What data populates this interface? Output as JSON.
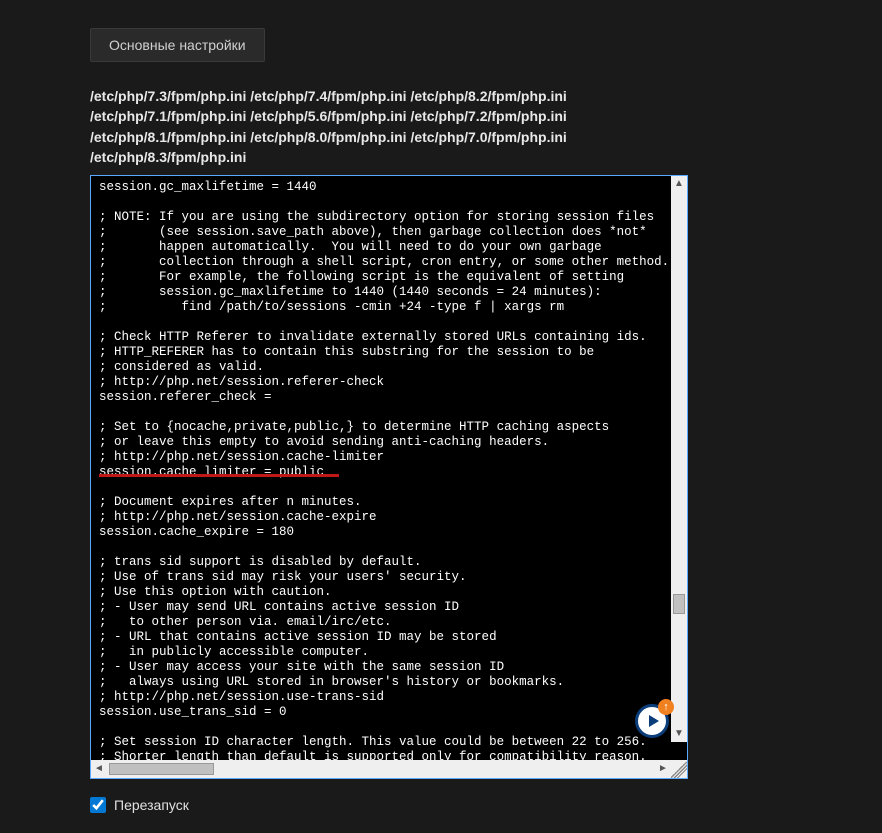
{
  "toolbar": {
    "main_settings_label": "Основные настройки"
  },
  "paths": {
    "line1": "/etc/php/7.3/fpm/php.ini /etc/php/7.4/fpm/php.ini /etc/php/8.2/fpm/php.ini",
    "line2": "/etc/php/7.1/fpm/php.ini /etc/php/5.6/fpm/php.ini /etc/php/7.2/fpm/php.ini",
    "line3": "/etc/php/8.1/fpm/php.ini /etc/php/8.0/fpm/php.ini /etc/php/7.0/fpm/php.ini",
    "line4": "/etc/php/8.3/fpm/php.ini"
  },
  "editor": {
    "content": "session.gc_maxlifetime = 1440\n\n; NOTE: If you are using the subdirectory option for storing session files\n;       (see session.save_path above), then garbage collection does *not*\n;       happen automatically.  You will need to do your own garbage\n;       collection through a shell script, cron entry, or some other method.\n;       For example, the following script is the equivalent of setting\n;       session.gc_maxlifetime to 1440 (1440 seconds = 24 minutes):\n;          find /path/to/sessions -cmin +24 -type f | xargs rm\n\n; Check HTTP Referer to invalidate externally stored URLs containing ids.\n; HTTP_REFERER has to contain this substring for the session to be\n; considered as valid.\n; http://php.net/session.referer-check\nsession.referer_check =\n\n; Set to {nocache,private,public,} to determine HTTP caching aspects\n; or leave this empty to avoid sending anti-caching headers.\n; http://php.net/session.cache-limiter\nsession.cache_limiter = public\n\n; Document expires after n minutes.\n; http://php.net/session.cache-expire\nsession.cache_expire = 180\n\n; trans sid support is disabled by default.\n; Use of trans sid may risk your users' security.\n; Use this option with caution.\n; - User may send URL contains active session ID\n;   to other person via. email/irc/etc.\n; - URL that contains active session ID may be stored\n;   in publicly accessible computer.\n; - User may access your site with the same session ID\n;   always using URL stored in browser's history or bookmarks.\n; http://php.net/session.use-trans-sid\nsession.use_trans_sid = 0\n\n; Set session ID character length. This value could be between 22 to 256.\n; Shorter length than default is supported only for compatibility reason."
  },
  "restart": {
    "label": "Перезапуск",
    "checked": true
  },
  "fab": {
    "badge": "↑"
  }
}
